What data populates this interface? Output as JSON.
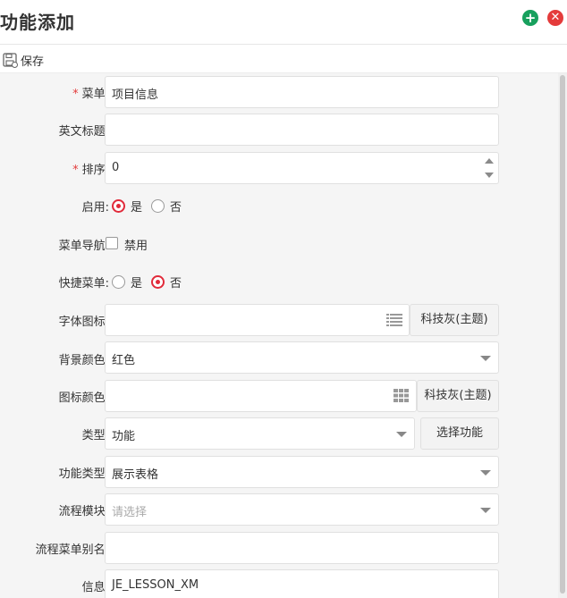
{
  "header": {
    "title": "功能添加",
    "add_icon": "plus-circle-icon",
    "close_icon": "close-circle-icon"
  },
  "toolbar": {
    "save_label": "保存",
    "save_icon": "save-icon"
  },
  "form": {
    "menu": {
      "label": "菜单:",
      "value": "项目信息",
      "required": true
    },
    "english_title": {
      "label": "英文标题:",
      "value": ""
    },
    "order": {
      "label": "排序:",
      "value": "0",
      "required": true
    },
    "enabled": {
      "label": "启用:",
      "options": [
        "是",
        "否"
      ],
      "selected": "是"
    },
    "menu_nav": {
      "label": "菜单导航:",
      "checkbox_label": "禁用",
      "checked": false
    },
    "quick_menu": {
      "label": "快捷菜单:",
      "options": [
        "是",
        "否"
      ],
      "selected": "否"
    },
    "font_icon": {
      "label": "字体图标:",
      "value": "",
      "button": "科技灰(主题)",
      "icon": "list-icon"
    },
    "bg_color": {
      "label": "背景颜色:",
      "value": "红色"
    },
    "icon_color": {
      "label": "图标颜色:",
      "value": "",
      "button": "科技灰(主题)",
      "icon": "grid-icon"
    },
    "type": {
      "label": "类型:",
      "value": "功能",
      "button": "选择功能"
    },
    "func_type": {
      "label": "功能类型:",
      "value": "展示表格"
    },
    "flow_module": {
      "label": "流程模块:",
      "placeholder": "请选择"
    },
    "flow_alias": {
      "label": "流程菜单别名:",
      "value": ""
    },
    "info": {
      "label": "信息:",
      "value": "JE_LESSON_XM"
    }
  },
  "colors": {
    "accent_red": "#e12a3a",
    "add_green": "#17a05d",
    "close_red": "#e43b3b"
  }
}
